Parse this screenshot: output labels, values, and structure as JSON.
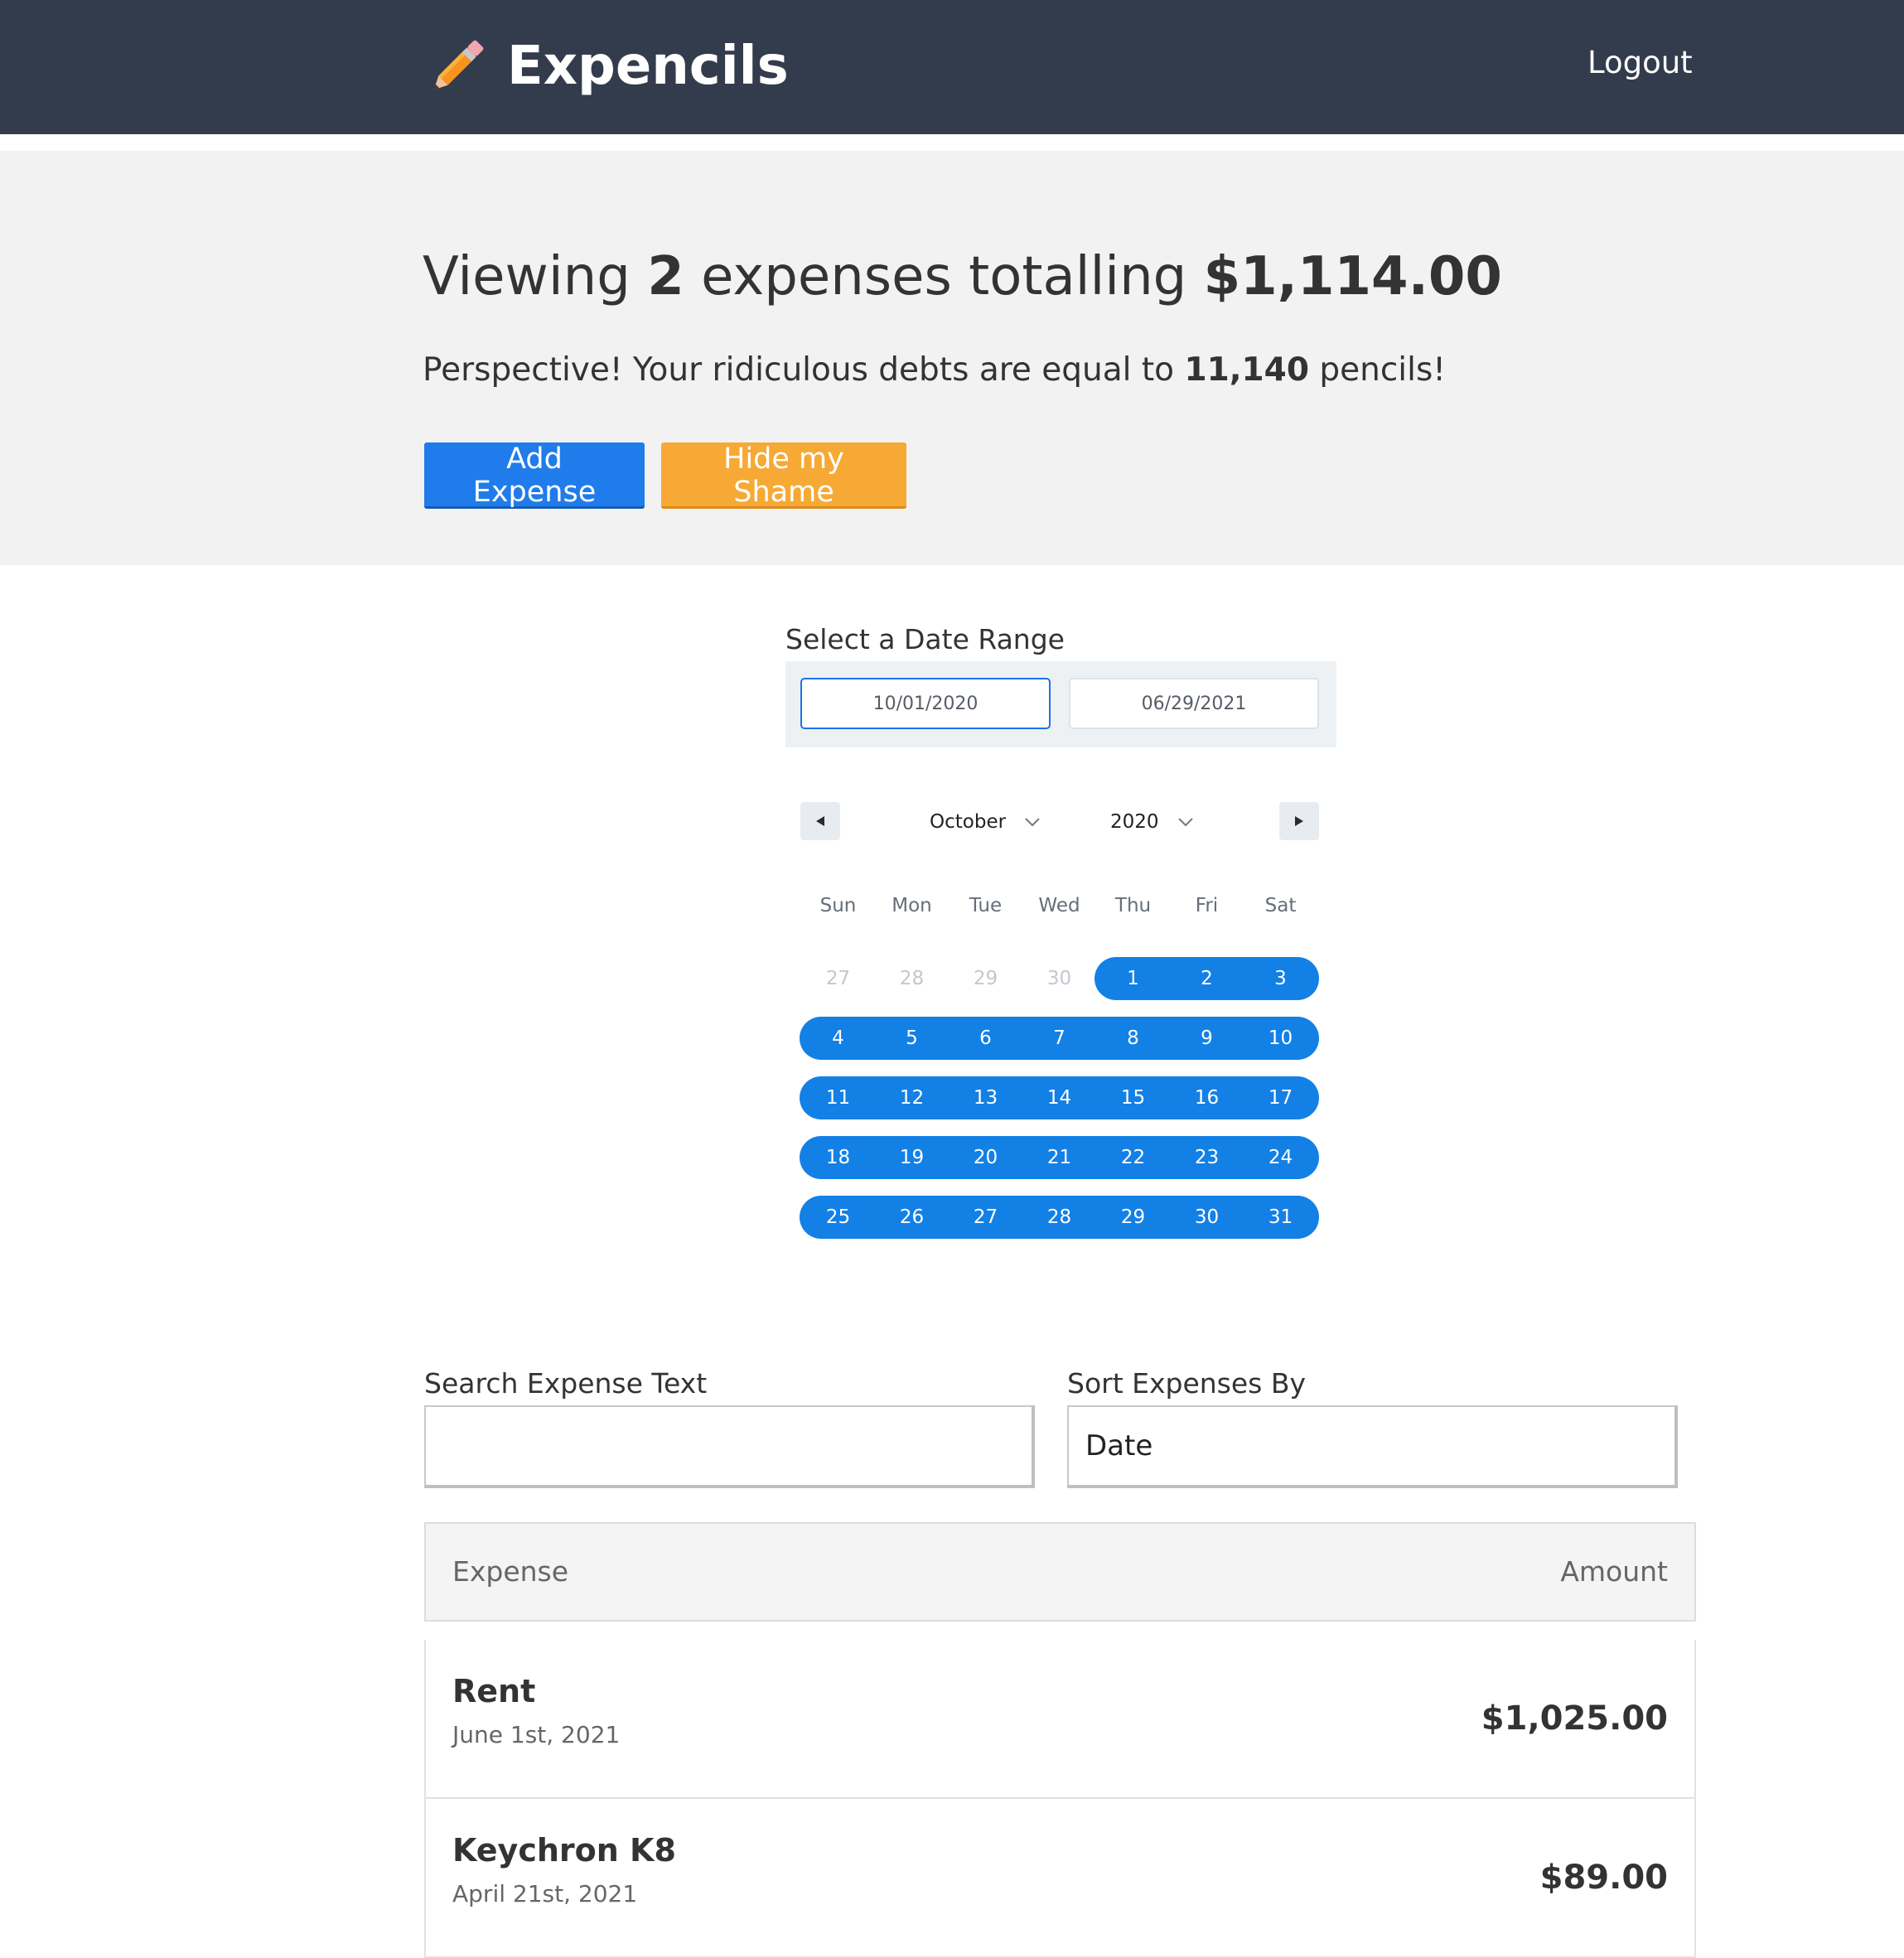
{
  "header": {
    "app_title": "Expencils",
    "logout_label": "Logout"
  },
  "summary": {
    "prefix": "Viewing",
    "count": "2",
    "middle": "expenses totalling",
    "total": "$1,114.00",
    "perspective_prefix": "Perspective! Your ridiculous debts are equal to",
    "pencils": "11,140",
    "perspective_suffix": "pencils!",
    "add_label": "Add Expense",
    "hide_label": "Hide my Shame"
  },
  "date_range": {
    "label": "Select a Date Range",
    "start": "10/01/2020",
    "end": "06/29/2021"
  },
  "calendar": {
    "month": "October",
    "year": "2020",
    "weekdays": [
      "Sun",
      "Mon",
      "Tue",
      "Wed",
      "Thu",
      "Fri",
      "Sat"
    ],
    "weeks": [
      [
        "27",
        "28",
        "29",
        "30",
        "1",
        "2",
        "3"
      ],
      [
        "4",
        "5",
        "6",
        "7",
        "8",
        "9",
        "10"
      ],
      [
        "11",
        "12",
        "13",
        "14",
        "15",
        "16",
        "17"
      ],
      [
        "18",
        "19",
        "20",
        "21",
        "22",
        "23",
        "24"
      ],
      [
        "25",
        "26",
        "27",
        "28",
        "29",
        "30",
        "31"
      ]
    ],
    "outside_days": 4,
    "accent": "#1380e6"
  },
  "filters": {
    "search_label": "Search Expense Text",
    "search_value": "",
    "sort_label": "Sort Expenses By",
    "sort_value": "Date"
  },
  "list": {
    "header_expense": "Expense",
    "header_amount": "Amount",
    "items": [
      {
        "description": "Rent",
        "date": "June 1st, 2021",
        "amount": "$1,025.00"
      },
      {
        "description": "Keychron K8",
        "date": "April 21st, 2021",
        "amount": "$89.00"
      }
    ]
  },
  "colors": {
    "header_bg": "#333c4c",
    "primary": "#1f7cea",
    "warning": "#f7a935"
  },
  "icons": {
    "brand": "pencil-icon",
    "prev": "arrow-left-icon",
    "next": "arrow-right-icon",
    "select": "chevron-down-icon"
  }
}
